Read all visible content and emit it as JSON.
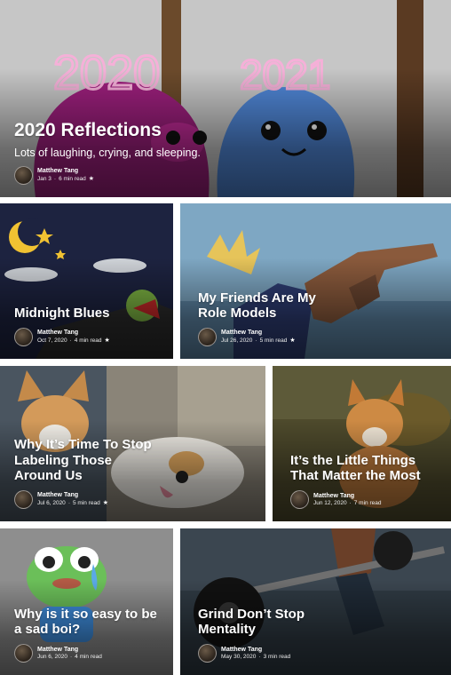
{
  "author": "Matthew Tang",
  "cards": [
    {
      "title": "2020 Reflections",
      "subtitle": "Lots of laughing, crying, and sleeping.",
      "date": "Jan 3",
      "read": "6 min read",
      "starred": true
    },
    {
      "title": "Midnight Blues",
      "date": "Oct 7, 2020",
      "read": "4 min read",
      "starred": true
    },
    {
      "title": "My Friends Are My Role Models",
      "date": "Jul 26, 2020",
      "read": "5 min read",
      "starred": true
    },
    {
      "title": "Why It’s Time To Stop Labeling Those Around Us",
      "date": "Jul 6, 2020",
      "read": "5 min read",
      "starred": true
    },
    {
      "title": "It’s the Little Things That Matter the Most",
      "date": "Jun 12, 2020",
      "read": "7 min read",
      "starred": false
    },
    {
      "title": "Why is it so easy to be a sad boi?",
      "date": "Jun 6, 2020",
      "read": "4 min read",
      "starred": false
    },
    {
      "title": "Grind Don’t Stop Mentality",
      "date": "May 30, 2020",
      "read": "3 min read",
      "starred": false
    }
  ],
  "hero_art": {
    "year_left": "2020",
    "year_right": "2021"
  },
  "icons": {
    "star": "star-icon"
  }
}
